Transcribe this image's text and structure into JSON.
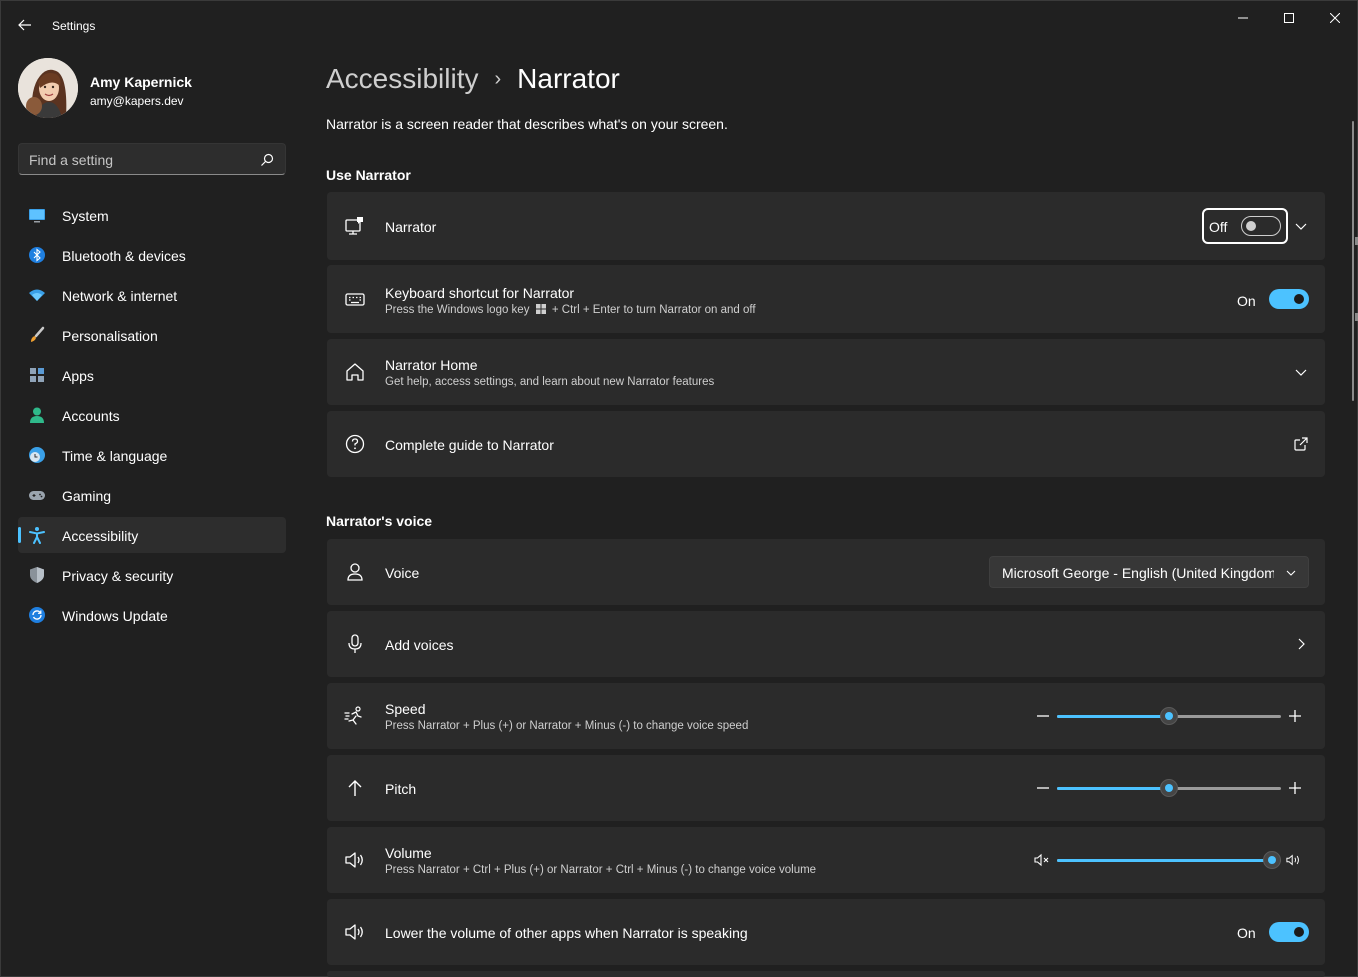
{
  "window": {
    "title": "Settings",
    "controls": [
      "minimize-icon",
      "maximize-icon",
      "close-icon"
    ]
  },
  "profile": {
    "name": "Amy Kapernick",
    "email": "amy@kapers.dev"
  },
  "search": {
    "placeholder": "Find a setting"
  },
  "sidebar": {
    "items": [
      {
        "label": "System",
        "icon": "monitor-icon",
        "active": false
      },
      {
        "label": "Bluetooth & devices",
        "icon": "bluetooth-icon",
        "active": false
      },
      {
        "label": "Network & internet",
        "icon": "wifi-icon",
        "active": false
      },
      {
        "label": "Personalisation",
        "icon": "brush-icon",
        "active": false
      },
      {
        "label": "Apps",
        "icon": "apps-icon",
        "active": false
      },
      {
        "label": "Accounts",
        "icon": "person-icon",
        "active": false
      },
      {
        "label": "Time & language",
        "icon": "clock-globe-icon",
        "active": false
      },
      {
        "label": "Gaming",
        "icon": "gamepad-icon",
        "active": false
      },
      {
        "label": "Accessibility",
        "icon": "accessibility-icon",
        "active": true
      },
      {
        "label": "Privacy & security",
        "icon": "shield-icon",
        "active": false
      },
      {
        "label": "Windows Update",
        "icon": "update-icon",
        "active": false
      }
    ]
  },
  "main": {
    "breadcrumb_parent": "Accessibility",
    "breadcrumb_separator": "›",
    "breadcrumb_current": "Narrator",
    "description": "Narrator is a screen reader that describes what's on your screen.",
    "sections": {
      "use_narrator": "Use Narrator",
      "voice": "Narrator's voice"
    },
    "narrator": {
      "title": "Narrator",
      "state": "Off"
    },
    "keyboard_shortcut": {
      "title": "Keyboard shortcut for Narrator",
      "subtitle_before": "Press the Windows logo key",
      "subtitle_after": "+ Ctrl + Enter to turn Narrator on and off",
      "state": "On"
    },
    "narrator_home": {
      "title": "Narrator Home",
      "subtitle": "Get help, access settings, and learn about new Narrator features"
    },
    "guide": {
      "title": "Complete guide to Narrator"
    },
    "voice": {
      "title": "Voice",
      "selected": "Microsoft George - English (United Kingdom)"
    },
    "add_voices": {
      "title": "Add voices"
    },
    "speed": {
      "title": "Speed",
      "subtitle": "Press Narrator + Plus (+) or Narrator + Minus (-) to change voice speed",
      "value_fraction": 0.5
    },
    "pitch": {
      "title": "Pitch",
      "value_fraction": 0.5
    },
    "volume": {
      "title": "Volume",
      "subtitle": "Press Narrator + Ctrl + Plus (+) or Narrator + Ctrl + Minus (-) to change voice volume",
      "value_fraction": 0.96
    },
    "lower_volume": {
      "title": "Lower the volume of other apps when Narrator is speaking",
      "state": "On"
    }
  },
  "colors": {
    "accent": "#4cc2ff",
    "background": "#202020",
    "card": "#2b2b2b"
  }
}
